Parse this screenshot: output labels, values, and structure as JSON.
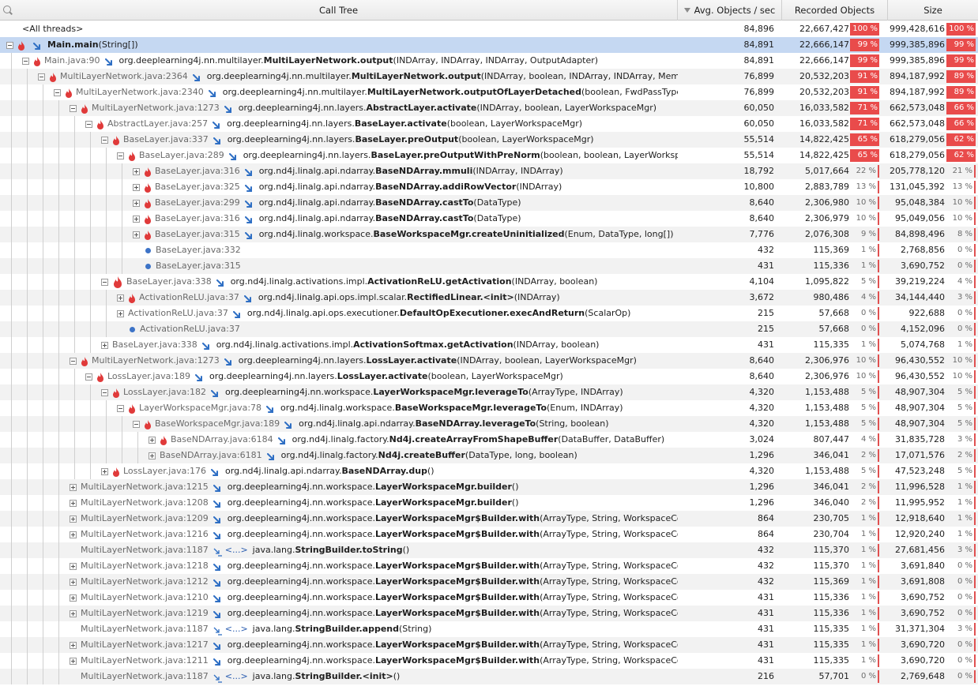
{
  "header": {
    "call_tree": "Call Tree",
    "avg": "Avg. Objects / sec",
    "recorded": "Recorded Objects",
    "size": "Size"
  },
  "colors": {
    "hot": "#e94b4b",
    "selected": "#c5d8f2",
    "arrow": "#2f6fc4",
    "fire": "#e03a3a"
  },
  "rows": [
    {
      "indent": 0,
      "exp": "none",
      "icon": "none",
      "loc": "",
      "pre": "",
      "bold": "",
      "post": "<All threads>",
      "avg": "84,896",
      "rec": "22,667,427",
      "rp": "100 %",
      "size": "999,428,616",
      "sp": "100 %",
      "hot": true,
      "shot": true
    },
    {
      "indent": 0,
      "exp": "minus",
      "icon": "fire",
      "arrow": true,
      "loc": "",
      "pre": "",
      "bold": "Main.main",
      "post": "(String[])",
      "avg": "84,891",
      "rec": "22,666,147",
      "rp": "99 %",
      "size": "999,385,896",
      "sp": "99 %",
      "hot": true,
      "shot": true,
      "selected": true
    },
    {
      "indent": 1,
      "exp": "minus",
      "icon": "fire",
      "arrow": true,
      "loc": "Main.java:90",
      "pre": "org.deeplearning4j.nn.multilayer.",
      "bold": "MultiLayerNetwork.output",
      "post": "(INDArray, INDArray, INDArray, OutputAdapter)",
      "avg": "84,891",
      "rec": "22,666,147",
      "rp": "99 %",
      "size": "999,385,896",
      "sp": "99 %",
      "hot": true,
      "shot": true
    },
    {
      "indent": 2,
      "exp": "minus",
      "icon": "fire",
      "arrow": true,
      "loc": "MultiLayerNetwork.java:2364",
      "pre": "org.deeplearning4j.nn.multilayer.",
      "bold": "MultiLayerNetwork.output",
      "post": "(INDArray, boolean, INDArray, INDArray, MemoryWo",
      "avg": "76,899",
      "rec": "20,532,203",
      "rp": "91 %",
      "size": "894,187,992",
      "sp": "89 %",
      "hot": true,
      "shot": true
    },
    {
      "indent": 3,
      "exp": "minus",
      "icon": "fire",
      "arrow": true,
      "loc": "MultiLayerNetwork.java:2340",
      "pre": "org.deeplearning4j.nn.multilayer.",
      "bold": "MultiLayerNetwork.outputOfLayerDetached",
      "post": "(boolean, FwdPassType, int, IN",
      "avg": "76,899",
      "rec": "20,532,203",
      "rp": "91 %",
      "size": "894,187,992",
      "sp": "89 %",
      "hot": true,
      "shot": true
    },
    {
      "indent": 4,
      "exp": "minus",
      "icon": "fire",
      "arrow": true,
      "loc": "MultiLayerNetwork.java:1273",
      "pre": "org.deeplearning4j.nn.layers.",
      "bold": "AbstractLayer.activate",
      "post": "(INDArray, boolean, LayerWorkspaceMgr)",
      "avg": "60,050",
      "rec": "16,033,582",
      "rp": "71 %",
      "size": "662,573,048",
      "sp": "66 %",
      "hot": true,
      "shot": true
    },
    {
      "indent": 5,
      "exp": "minus",
      "icon": "fire",
      "arrow": true,
      "loc": "AbstractLayer.java:257",
      "pre": "org.deeplearning4j.nn.layers.",
      "bold": "BaseLayer.activate",
      "post": "(boolean, LayerWorkspaceMgr)",
      "avg": "60,050",
      "rec": "16,033,582",
      "rp": "71 %",
      "size": "662,573,048",
      "sp": "66 %",
      "hot": true,
      "shot": true
    },
    {
      "indent": 6,
      "exp": "minus",
      "icon": "fire",
      "arrow": true,
      "loc": "BaseLayer.java:337",
      "pre": "org.deeplearning4j.nn.layers.",
      "bold": "BaseLayer.preOutput",
      "post": "(boolean, LayerWorkspaceMgr)",
      "avg": "55,514",
      "rec": "14,822,425",
      "rp": "65 %",
      "size": "618,279,056",
      "sp": "62 %",
      "hot": true,
      "shot": true
    },
    {
      "indent": 7,
      "exp": "minus",
      "icon": "fire",
      "arrow": true,
      "loc": "BaseLayer.java:289",
      "pre": "org.deeplearning4j.nn.layers.",
      "bold": "BaseLayer.preOutputWithPreNorm",
      "post": "(boolean, boolean, LayerWorkspaceMg",
      "avg": "55,514",
      "rec": "14,822,425",
      "rp": "65 %",
      "size": "618,279,056",
      "sp": "62 %",
      "hot": true,
      "shot": true
    },
    {
      "indent": 8,
      "exp": "plus",
      "icon": "fire",
      "arrow": true,
      "loc": "BaseLayer.java:316",
      "pre": "org.nd4j.linalg.api.ndarray.",
      "bold": "BaseNDArray.mmuli",
      "post": "(INDArray, INDArray)",
      "avg": "18,792",
      "rec": "5,017,664",
      "rp": "22 %",
      "size": "205,778,120",
      "sp": "21 %",
      "hot": false,
      "shot": false
    },
    {
      "indent": 8,
      "exp": "plus",
      "icon": "fire",
      "arrow": true,
      "loc": "BaseLayer.java:325",
      "pre": "org.nd4j.linalg.api.ndarray.",
      "bold": "BaseNDArray.addiRowVector",
      "post": "(INDArray)",
      "avg": "10,800",
      "rec": "2,883,789",
      "rp": "13 %",
      "size": "131,045,392",
      "sp": "13 %",
      "hot": false,
      "shot": false
    },
    {
      "indent": 8,
      "exp": "plus",
      "icon": "fire",
      "arrow": true,
      "loc": "BaseLayer.java:299",
      "pre": "org.nd4j.linalg.api.ndarray.",
      "bold": "BaseNDArray.castTo",
      "post": "(DataType)",
      "avg": "8,640",
      "rec": "2,306,980",
      "rp": "10 %",
      "size": "95,048,384",
      "sp": "10 %",
      "hot": false,
      "shot": false
    },
    {
      "indent": 8,
      "exp": "plus",
      "icon": "fire",
      "arrow": true,
      "loc": "BaseLayer.java:316",
      "pre": "org.nd4j.linalg.api.ndarray.",
      "bold": "BaseNDArray.castTo",
      "post": "(DataType)",
      "avg": "8,640",
      "rec": "2,306,979",
      "rp": "10 %",
      "size": "95,049,056",
      "sp": "10 %",
      "hot": false,
      "shot": false
    },
    {
      "indent": 8,
      "exp": "plus",
      "icon": "fire",
      "arrow": true,
      "loc": "BaseLayer.java:315",
      "pre": "org.nd4j.linalg.workspace.",
      "bold": "BaseWorkspaceMgr.createUninitialized",
      "post": "(Enum, DataType, long[])",
      "avg": "7,776",
      "rec": "2,076,308",
      "rp": "9 %",
      "size": "84,898,496",
      "sp": "8 %",
      "hot": false,
      "shot": false
    },
    {
      "indent": 8,
      "exp": "none",
      "icon": "dot",
      "loc": "BaseLayer.java:332",
      "pre": "",
      "bold": "",
      "post": "",
      "avg": "432",
      "rec": "115,369",
      "rp": "1 %",
      "size": "2,768,856",
      "sp": "0 %",
      "hot": false,
      "shot": false
    },
    {
      "indent": 8,
      "exp": "none",
      "icon": "dot",
      "loc": "BaseLayer.java:315",
      "pre": "",
      "bold": "",
      "post": "",
      "avg": "431",
      "rec": "115,336",
      "rp": "1 %",
      "size": "3,690,752",
      "sp": "0 %",
      "hot": false,
      "shot": false
    },
    {
      "indent": 6,
      "exp": "minus",
      "icon": "bigfire",
      "arrow": true,
      "loc": "BaseLayer.java:338",
      "pre": "org.nd4j.linalg.activations.impl.",
      "bold": "ActivationReLU.getActivation",
      "post": "(INDArray, boolean)",
      "avg": "4,104",
      "rec": "1,095,822",
      "rp": "5 %",
      "size": "39,219,224",
      "sp": "4 %",
      "hot": false,
      "shot": false
    },
    {
      "indent": 7,
      "exp": "plus",
      "icon": "fire",
      "arrow": true,
      "loc": "ActivationReLU.java:37",
      "pre": "org.nd4j.linalg.api.ops.impl.scalar.",
      "bold": "RectifiedLinear.<init>",
      "post": "(INDArray)",
      "avg": "3,672",
      "rec": "980,486",
      "rp": "4 %",
      "size": "34,144,440",
      "sp": "3 %",
      "hot": false,
      "shot": false
    },
    {
      "indent": 7,
      "exp": "plus",
      "icon": "none",
      "arrow": true,
      "loc": "ActivationReLU.java:37",
      "pre": "org.nd4j.linalg.api.ops.executioner.",
      "bold": "DefaultOpExecutioner.execAndReturn",
      "post": "(ScalarOp)",
      "avg": "215",
      "rec": "57,668",
      "rp": "0 %",
      "size": "922,688",
      "sp": "0 %",
      "hot": false,
      "shot": false
    },
    {
      "indent": 7,
      "exp": "none",
      "icon": "dot",
      "loc": "ActivationReLU.java:37",
      "pre": "",
      "bold": "",
      "post": "",
      "avg": "215",
      "rec": "57,668",
      "rp": "0 %",
      "size": "4,152,096",
      "sp": "0 %",
      "hot": false,
      "shot": false
    },
    {
      "indent": 6,
      "exp": "plus",
      "icon": "none",
      "arrow": true,
      "loc": "BaseLayer.java:338",
      "pre": "org.nd4j.linalg.activations.impl.",
      "bold": "ActivationSoftmax.getActivation",
      "post": "(INDArray, boolean)",
      "avg": "431",
      "rec": "115,335",
      "rp": "1 %",
      "size": "5,074,768",
      "sp": "1 %",
      "hot": false,
      "shot": false
    },
    {
      "indent": 4,
      "exp": "minus",
      "icon": "fire",
      "arrow": true,
      "loc": "MultiLayerNetwork.java:1273",
      "pre": "org.deeplearning4j.nn.layers.",
      "bold": "LossLayer.activate",
      "post": "(INDArray, boolean, LayerWorkspaceMgr)",
      "avg": "8,640",
      "rec": "2,306,976",
      "rp": "10 %",
      "size": "96,430,552",
      "sp": "10 %",
      "hot": false,
      "shot": false
    },
    {
      "indent": 5,
      "exp": "minus",
      "icon": "fire",
      "arrow": true,
      "loc": "LossLayer.java:189",
      "pre": "org.deeplearning4j.nn.layers.",
      "bold": "LossLayer.activate",
      "post": "(boolean, LayerWorkspaceMgr)",
      "avg": "8,640",
      "rec": "2,306,976",
      "rp": "10 %",
      "size": "96,430,552",
      "sp": "10 %",
      "hot": false,
      "shot": false
    },
    {
      "indent": 6,
      "exp": "minus",
      "icon": "fire",
      "arrow": true,
      "loc": "LossLayer.java:182",
      "pre": "org.deeplearning4j.nn.workspace.",
      "bold": "LayerWorkspaceMgr.leverageTo",
      "post": "(ArrayType, INDArray)",
      "avg": "4,320",
      "rec": "1,153,488",
      "rp": "5 %",
      "size": "48,907,304",
      "sp": "5 %",
      "hot": false,
      "shot": false
    },
    {
      "indent": 7,
      "exp": "minus",
      "icon": "fire",
      "arrow": true,
      "loc": "LayerWorkspaceMgr.java:78",
      "pre": "org.nd4j.linalg.workspace.",
      "bold": "BaseWorkspaceMgr.leverageTo",
      "post": "(Enum, INDArray)",
      "avg": "4,320",
      "rec": "1,153,488",
      "rp": "5 %",
      "size": "48,907,304",
      "sp": "5 %",
      "hot": false,
      "shot": false
    },
    {
      "indent": 8,
      "exp": "minus",
      "icon": "fire",
      "arrow": true,
      "loc": "BaseWorkspaceMgr.java:189",
      "pre": "org.nd4j.linalg.api.ndarray.",
      "bold": "BaseNDArray.leverageTo",
      "post": "(String, boolean)",
      "avg": "4,320",
      "rec": "1,153,488",
      "rp": "5 %",
      "size": "48,907,304",
      "sp": "5 %",
      "hot": false,
      "shot": false
    },
    {
      "indent": 9,
      "exp": "plus",
      "icon": "fire",
      "arrow": true,
      "loc": "BaseNDArray.java:6184",
      "pre": "org.nd4j.linalg.factory.",
      "bold": "Nd4j.createArrayFromShapeBuffer",
      "post": "(DataBuffer, DataBuffer)",
      "avg": "3,024",
      "rec": "807,447",
      "rp": "4 %",
      "size": "31,835,728",
      "sp": "3 %",
      "hot": false,
      "shot": false
    },
    {
      "indent": 9,
      "exp": "plus",
      "icon": "none",
      "arrow": true,
      "loc": "BaseNDArray.java:6181",
      "pre": "org.nd4j.linalg.factory.",
      "bold": "Nd4j.createBuffer",
      "post": "(DataType, long, boolean)",
      "avg": "1,296",
      "rec": "346,041",
      "rp": "2 %",
      "size": "17,071,576",
      "sp": "2 %",
      "hot": false,
      "shot": false
    },
    {
      "indent": 6,
      "exp": "plus",
      "icon": "fire",
      "arrow": true,
      "loc": "LossLayer.java:176",
      "pre": "org.nd4j.linalg.api.ndarray.",
      "bold": "BaseNDArray.dup",
      "post": "()",
      "avg": "4,320",
      "rec": "1,153,488",
      "rp": "5 %",
      "size": "47,523,248",
      "sp": "5 %",
      "hot": false,
      "shot": false
    },
    {
      "indent": 4,
      "exp": "plus",
      "icon": "none",
      "arrow": true,
      "loc": "MultiLayerNetwork.java:1215",
      "pre": "org.deeplearning4j.nn.workspace.",
      "bold": "LayerWorkspaceMgr.builder",
      "post": "()",
      "avg": "1,296",
      "rec": "346,041",
      "rp": "2 %",
      "size": "11,996,528",
      "sp": "1 %",
      "hot": false,
      "shot": false
    },
    {
      "indent": 4,
      "exp": "plus",
      "icon": "none",
      "arrow": true,
      "loc": "MultiLayerNetwork.java:1208",
      "pre": "org.deeplearning4j.nn.workspace.",
      "bold": "LayerWorkspaceMgr.builder",
      "post": "()",
      "avg": "1,296",
      "rec": "346,040",
      "rp": "2 %",
      "size": "11,995,952",
      "sp": "1 %",
      "hot": false,
      "shot": false
    },
    {
      "indent": 4,
      "exp": "plus",
      "icon": "none",
      "arrow": true,
      "loc": "MultiLayerNetwork.java:1209",
      "pre": "org.deeplearning4j.nn.workspace.",
      "bold": "LayerWorkspaceMgr$Builder.with",
      "post": "(ArrayType, String, WorkspaceConfigur",
      "avg": "864",
      "rec": "230,705",
      "rp": "1 %",
      "size": "12,918,640",
      "sp": "1 %",
      "hot": false,
      "shot": false
    },
    {
      "indent": 4,
      "exp": "plus",
      "icon": "none",
      "arrow": true,
      "loc": "MultiLayerNetwork.java:1216",
      "pre": "org.deeplearning4j.nn.workspace.",
      "bold": "LayerWorkspaceMgr$Builder.with",
      "post": "(ArrayType, String, WorkspaceConfigur",
      "avg": "864",
      "rec": "230,704",
      "rp": "1 %",
      "size": "12,920,240",
      "sp": "1 %",
      "hot": false,
      "shot": false
    },
    {
      "indent": 4,
      "exp": "none",
      "icon": "none",
      "arrow": false,
      "lambda": true,
      "loc": "MultiLayerNetwork.java:1187",
      "lam": "<...>",
      "pre": "java.lang.",
      "bold": "StringBuilder.toString",
      "post": "()",
      "avg": "432",
      "rec": "115,370",
      "rp": "1 %",
      "size": "27,681,456",
      "sp": "3 %",
      "hot": false,
      "shot": false
    },
    {
      "indent": 4,
      "exp": "plus",
      "icon": "none",
      "arrow": true,
      "loc": "MultiLayerNetwork.java:1218",
      "pre": "org.deeplearning4j.nn.workspace.",
      "bold": "LayerWorkspaceMgr$Builder.with",
      "post": "(ArrayType, String, WorkspaceConfigur",
      "avg": "432",
      "rec": "115,370",
      "rp": "1 %",
      "size": "3,691,840",
      "sp": "0 %",
      "hot": false,
      "shot": false
    },
    {
      "indent": 4,
      "exp": "plus",
      "icon": "none",
      "arrow": true,
      "loc": "MultiLayerNetwork.java:1212",
      "pre": "org.deeplearning4j.nn.workspace.",
      "bold": "LayerWorkspaceMgr$Builder.with",
      "post": "(ArrayType, String, WorkspaceConfigur",
      "avg": "432",
      "rec": "115,369",
      "rp": "1 %",
      "size": "3,691,808",
      "sp": "0 %",
      "hot": false,
      "shot": false
    },
    {
      "indent": 4,
      "exp": "plus",
      "icon": "none",
      "arrow": true,
      "loc": "MultiLayerNetwork.java:1210",
      "pre": "org.deeplearning4j.nn.workspace.",
      "bold": "LayerWorkspaceMgr$Builder.with",
      "post": "(ArrayType, String, WorkspaceConfigur",
      "avg": "431",
      "rec": "115,336",
      "rp": "1 %",
      "size": "3,690,752",
      "sp": "0 %",
      "hot": false,
      "shot": false
    },
    {
      "indent": 4,
      "exp": "plus",
      "icon": "none",
      "arrow": true,
      "loc": "MultiLayerNetwork.java:1219",
      "pre": "org.deeplearning4j.nn.workspace.",
      "bold": "LayerWorkspaceMgr$Builder.with",
      "post": "(ArrayType, String, WorkspaceConfigur",
      "avg": "431",
      "rec": "115,336",
      "rp": "1 %",
      "size": "3,690,752",
      "sp": "0 %",
      "hot": false,
      "shot": false
    },
    {
      "indent": 4,
      "exp": "none",
      "icon": "none",
      "arrow": false,
      "lambda": true,
      "loc": "MultiLayerNetwork.java:1187",
      "lam": "<...>",
      "pre": "java.lang.",
      "bold": "StringBuilder.append",
      "post": "(String)",
      "avg": "431",
      "rec": "115,335",
      "rp": "1 %",
      "size": "31,371,304",
      "sp": "3 %",
      "hot": false,
      "shot": false
    },
    {
      "indent": 4,
      "exp": "plus",
      "icon": "none",
      "arrow": true,
      "loc": "MultiLayerNetwork.java:1217",
      "pre": "org.deeplearning4j.nn.workspace.",
      "bold": "LayerWorkspaceMgr$Builder.with",
      "post": "(ArrayType, String, WorkspaceConfigur",
      "avg": "431",
      "rec": "115,335",
      "rp": "1 %",
      "size": "3,690,720",
      "sp": "0 %",
      "hot": false,
      "shot": false
    },
    {
      "indent": 4,
      "exp": "plus",
      "icon": "none",
      "arrow": true,
      "loc": "MultiLayerNetwork.java:1211",
      "pre": "org.deeplearning4j.nn.workspace.",
      "bold": "LayerWorkspaceMgr$Builder.with",
      "post": "(ArrayType, String, WorkspaceConfigur",
      "avg": "431",
      "rec": "115,335",
      "rp": "1 %",
      "size": "3,690,720",
      "sp": "0 %",
      "hot": false,
      "shot": false
    },
    {
      "indent": 4,
      "exp": "none",
      "icon": "none",
      "arrow": false,
      "lambda": true,
      "loc": "MultiLayerNetwork.java:1187",
      "lam": "<...>",
      "pre": "java.lang.",
      "bold": "StringBuilder.<init>",
      "post": "()",
      "avg": "216",
      "rec": "57,701",
      "rp": "0 %",
      "size": "2,769,648",
      "sp": "0 %",
      "hot": false,
      "shot": false
    }
  ]
}
